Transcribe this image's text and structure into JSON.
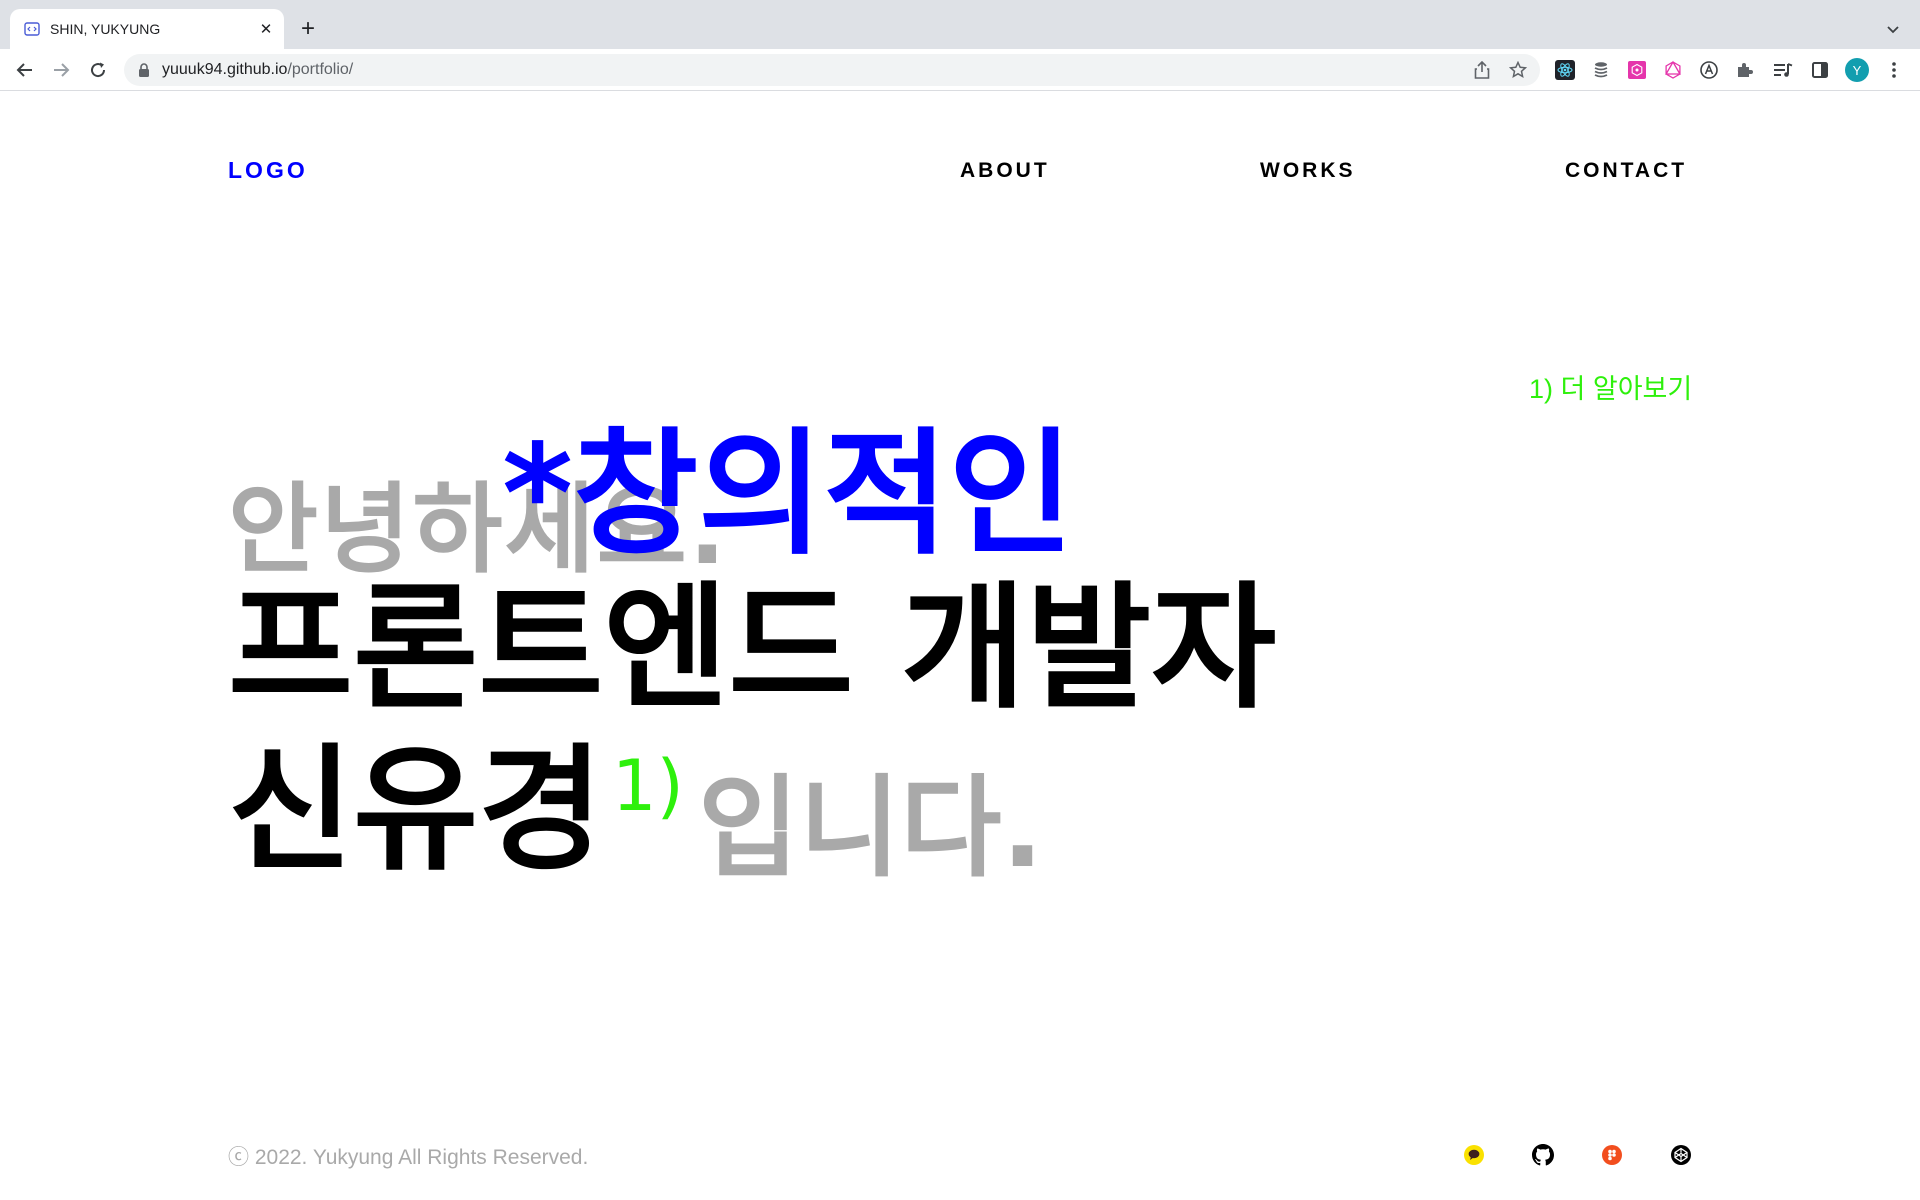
{
  "browser": {
    "tab": {
      "title": "SHIN, YUKYUNG"
    },
    "address": {
      "host": "yuuuk94.github.io",
      "path": "/portfolio/"
    },
    "profile_initial": "Y"
  },
  "header": {
    "logo": "LOGO",
    "nav": [
      "ABOUT",
      "WORKS",
      "CONTACT"
    ]
  },
  "hero": {
    "more_link": "1) 더 알아보기",
    "greeting": "안녕하세요.",
    "highlight": "*창의적인",
    "role": "프론트엔드 개발자",
    "name": "신유경",
    "note_marker": "1)",
    "ending": "입니다."
  },
  "footer": {
    "copyright": "ⓒ 2022. Yukyung All Rights Reserved.",
    "social_icons": [
      "kakaotalk-icon",
      "github-icon",
      "figma-icon",
      "codepen-icon"
    ]
  },
  "colors": {
    "accent_blue": "#0000ff",
    "accent_green": "#2ef00c",
    "muted_gray": "#a9a9a9"
  }
}
